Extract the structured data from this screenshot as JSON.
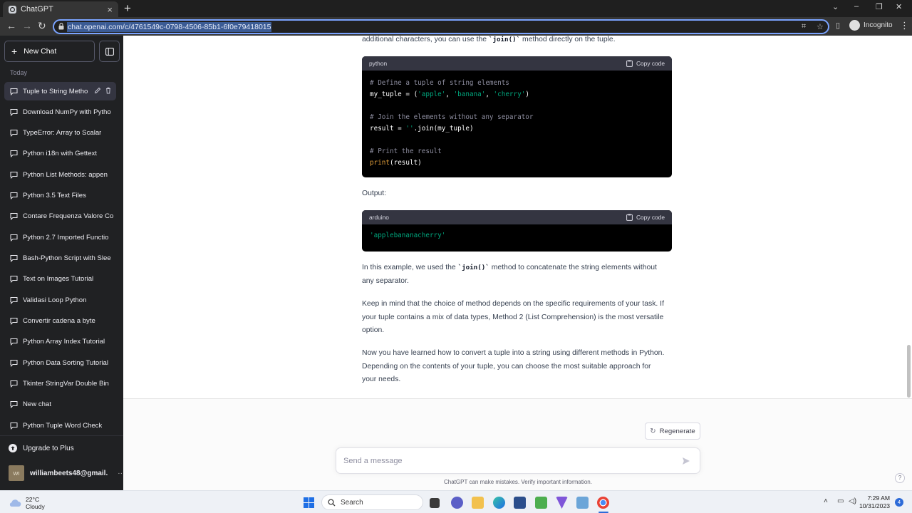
{
  "browser": {
    "tab_title": "ChatGPT",
    "url": "chat.openai.com/c/4761549c-0798-4506-85b1-6f0e79418015",
    "profile_label": "Incognito"
  },
  "sidebar": {
    "new_chat_label": "New Chat",
    "section_label": "Today",
    "conversations": [
      {
        "label": "Tuple to String Metho",
        "active": true
      },
      {
        "label": "Download NumPy with Pytho"
      },
      {
        "label": "TypeError: Array to Scalar"
      },
      {
        "label": "Python i18n with Gettext"
      },
      {
        "label": "Python List Methods: appen"
      },
      {
        "label": "Python 3.5 Text Files"
      },
      {
        "label": "Contare Frequenza Valore Co"
      },
      {
        "label": "Python 2.7 Imported Functio"
      },
      {
        "label": "Bash-Python Script with Slee"
      },
      {
        "label": "Text on Images Tutorial"
      },
      {
        "label": "Validasi Loop Python"
      },
      {
        "label": "Convertir cadena a byte"
      },
      {
        "label": "Python Array Index Tutorial"
      },
      {
        "label": "Python Data Sorting Tutorial"
      },
      {
        "label": "Tkinter StringVar Double Bin"
      },
      {
        "label": "New chat"
      },
      {
        "label": "Python Tuple Word Check"
      }
    ],
    "upgrade_label": "Upgrade to Plus",
    "user_initials": "WI",
    "user_email": "williambeets48@gmail.",
    "user_menu": "···"
  },
  "chat": {
    "intro_prefix": "additional characters, you can use the ",
    "intro_code": "`join()`",
    "intro_suffix": " method directly on the tuple.",
    "code1": {
      "lang": "python",
      "copy_label": "Copy code",
      "line1": "# Define a tuple of string elements",
      "line2_a": "my_tuple = (",
      "line2_s1": "'apple'",
      "line2_c1": ", ",
      "line2_s2": "'banana'",
      "line2_c2": ", ",
      "line2_s3": "'cherry'",
      "line2_end": ")",
      "line3": "# Join the elements without any separator",
      "line4_a": "result = ",
      "line4_s": "''",
      "line4_b": ".join(my_tuple)",
      "line5": "# Print the result",
      "line6_fn": "print",
      "line6_b": "(result)"
    },
    "output_label": "Output:",
    "code2": {
      "lang": "arduino",
      "copy_label": "Copy code",
      "line1": "'applebananacherry'"
    },
    "para1_prefix": "In this example, we used the ",
    "para1_code": "`join()`",
    "para1_line1_suffix": " method to concatenate the string elements without",
    "para1_line2": "any separator.",
    "para2_line1": "Keep in mind that the choice of method depends on the specific requirements of your task. If",
    "para2_line2": "your tuple contains a mix of data types, Method 2 (List Comprehension) is the most versatile",
    "para2_line3": "option.",
    "para3_line1": "Now you have learned how to convert a tuple into a string using different methods in Python.",
    "para3_line2": "Depending on the contents of your tuple, you can choose the most suitable approach for",
    "para3_line3": "your needs.",
    "regenerate_label": "Regenerate",
    "input_placeholder": "Send a message",
    "disclaimer": "ChatGPT can make mistakes. Verify important information.",
    "help_label": "?"
  },
  "taskbar": {
    "temperature": "22°C",
    "weather": "Cloudy",
    "search_label": "Search",
    "time": "7:29 AM",
    "date": "10/31/2023",
    "notification_count": "4"
  }
}
